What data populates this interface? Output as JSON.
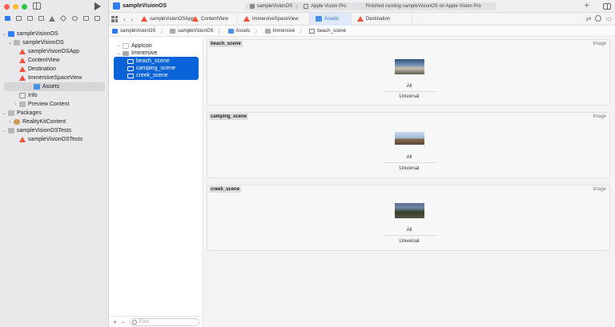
{
  "window": {
    "title": "sampleVisionOS"
  },
  "scheme_bar": {
    "scheme": "sampleVisionOS",
    "destination": "Apple Vision Pro",
    "status": "Finished running sampleVisionOS on Apple Vision Pro"
  },
  "tabs": [
    {
      "label": "sampleVisionOSApp",
      "icon": "swift-icon"
    },
    {
      "label": "ContentView",
      "icon": "swift-icon"
    },
    {
      "label": "ImmersiveSpaceView",
      "icon": "swift-icon"
    },
    {
      "label": "Assets",
      "icon": "asset-catalog-icon"
    },
    {
      "label": "Destination",
      "icon": "swift-icon"
    }
  ],
  "breadcrumb": [
    "sampleVisionOS",
    "sampleVisionOS",
    "Assets",
    "Immersive",
    "beach_scene"
  ],
  "navigator": {
    "items": [
      {
        "label": "sampleVisionOS",
        "icon": "project-icon"
      },
      {
        "label": "sampleVisionOS",
        "icon": "folder-icon"
      },
      {
        "label": "sampleVisionOSApp",
        "icon": "swift-icon"
      },
      {
        "label": "ContentView",
        "icon": "swift-icon"
      },
      {
        "label": "Destination",
        "icon": "swift-icon"
      },
      {
        "label": "ImmersiveSpaceView",
        "icon": "swift-icon"
      },
      {
        "label": "Assets",
        "icon": "asset-catalog-icon"
      },
      {
        "label": "Info",
        "icon": "plist-icon"
      },
      {
        "label": "Preview Content",
        "icon": "folder-icon"
      },
      {
        "label": "Packages",
        "icon": "folder-icon"
      },
      {
        "label": "RealityKitContent",
        "icon": "package-icon"
      },
      {
        "label": "sampleVisionOSTests",
        "icon": "folder-icon"
      },
      {
        "label": "sampleVisionOSTests",
        "icon": "swift-icon"
      }
    ]
  },
  "asset_list": {
    "appicon": "AppIcon",
    "folder": "Immersive",
    "images": [
      "beach_scene",
      "camping_scene",
      "creek_scene"
    ],
    "filter_placeholder": "Filter"
  },
  "asset_cards": [
    {
      "name": "beach_scene",
      "kind": "Image",
      "slot": "All",
      "idiom": "Universal"
    },
    {
      "name": "camping_scene",
      "kind": "Image",
      "slot": "All",
      "idiom": "Universal"
    },
    {
      "name": "creek_scene",
      "kind": "Image",
      "slot": "All",
      "idiom": "Universal"
    }
  ]
}
